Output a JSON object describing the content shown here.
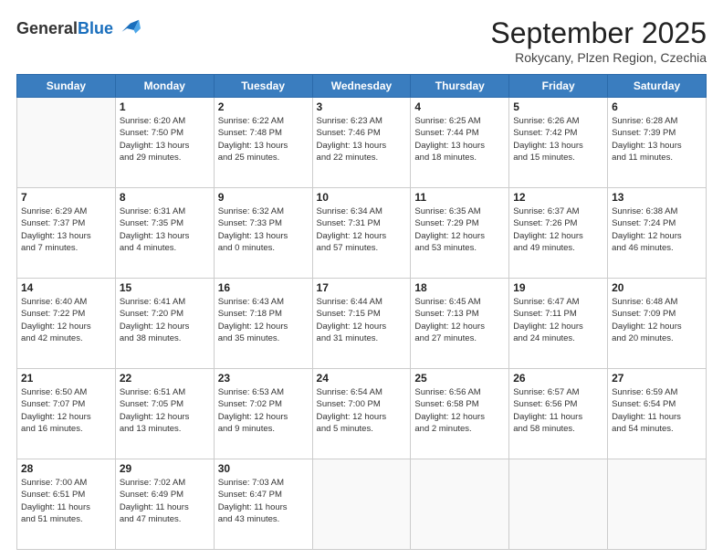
{
  "header": {
    "logo_line1": "General",
    "logo_line2": "Blue",
    "month": "September 2025",
    "location": "Rokycany, Plzen Region, Czechia"
  },
  "days_of_week": [
    "Sunday",
    "Monday",
    "Tuesday",
    "Wednesday",
    "Thursday",
    "Friday",
    "Saturday"
  ],
  "weeks": [
    [
      {
        "day": "",
        "info": ""
      },
      {
        "day": "1",
        "info": "Sunrise: 6:20 AM\nSunset: 7:50 PM\nDaylight: 13 hours\nand 29 minutes."
      },
      {
        "day": "2",
        "info": "Sunrise: 6:22 AM\nSunset: 7:48 PM\nDaylight: 13 hours\nand 25 minutes."
      },
      {
        "day": "3",
        "info": "Sunrise: 6:23 AM\nSunset: 7:46 PM\nDaylight: 13 hours\nand 22 minutes."
      },
      {
        "day": "4",
        "info": "Sunrise: 6:25 AM\nSunset: 7:44 PM\nDaylight: 13 hours\nand 18 minutes."
      },
      {
        "day": "5",
        "info": "Sunrise: 6:26 AM\nSunset: 7:42 PM\nDaylight: 13 hours\nand 15 minutes."
      },
      {
        "day": "6",
        "info": "Sunrise: 6:28 AM\nSunset: 7:39 PM\nDaylight: 13 hours\nand 11 minutes."
      }
    ],
    [
      {
        "day": "7",
        "info": "Sunrise: 6:29 AM\nSunset: 7:37 PM\nDaylight: 13 hours\nand 7 minutes."
      },
      {
        "day": "8",
        "info": "Sunrise: 6:31 AM\nSunset: 7:35 PM\nDaylight: 13 hours\nand 4 minutes."
      },
      {
        "day": "9",
        "info": "Sunrise: 6:32 AM\nSunset: 7:33 PM\nDaylight: 13 hours\nand 0 minutes."
      },
      {
        "day": "10",
        "info": "Sunrise: 6:34 AM\nSunset: 7:31 PM\nDaylight: 12 hours\nand 57 minutes."
      },
      {
        "day": "11",
        "info": "Sunrise: 6:35 AM\nSunset: 7:29 PM\nDaylight: 12 hours\nand 53 minutes."
      },
      {
        "day": "12",
        "info": "Sunrise: 6:37 AM\nSunset: 7:26 PM\nDaylight: 12 hours\nand 49 minutes."
      },
      {
        "day": "13",
        "info": "Sunrise: 6:38 AM\nSunset: 7:24 PM\nDaylight: 12 hours\nand 46 minutes."
      }
    ],
    [
      {
        "day": "14",
        "info": "Sunrise: 6:40 AM\nSunset: 7:22 PM\nDaylight: 12 hours\nand 42 minutes."
      },
      {
        "day": "15",
        "info": "Sunrise: 6:41 AM\nSunset: 7:20 PM\nDaylight: 12 hours\nand 38 minutes."
      },
      {
        "day": "16",
        "info": "Sunrise: 6:43 AM\nSunset: 7:18 PM\nDaylight: 12 hours\nand 35 minutes."
      },
      {
        "day": "17",
        "info": "Sunrise: 6:44 AM\nSunset: 7:15 PM\nDaylight: 12 hours\nand 31 minutes."
      },
      {
        "day": "18",
        "info": "Sunrise: 6:45 AM\nSunset: 7:13 PM\nDaylight: 12 hours\nand 27 minutes."
      },
      {
        "day": "19",
        "info": "Sunrise: 6:47 AM\nSunset: 7:11 PM\nDaylight: 12 hours\nand 24 minutes."
      },
      {
        "day": "20",
        "info": "Sunrise: 6:48 AM\nSunset: 7:09 PM\nDaylight: 12 hours\nand 20 minutes."
      }
    ],
    [
      {
        "day": "21",
        "info": "Sunrise: 6:50 AM\nSunset: 7:07 PM\nDaylight: 12 hours\nand 16 minutes."
      },
      {
        "day": "22",
        "info": "Sunrise: 6:51 AM\nSunset: 7:05 PM\nDaylight: 12 hours\nand 13 minutes."
      },
      {
        "day": "23",
        "info": "Sunrise: 6:53 AM\nSunset: 7:02 PM\nDaylight: 12 hours\nand 9 minutes."
      },
      {
        "day": "24",
        "info": "Sunrise: 6:54 AM\nSunset: 7:00 PM\nDaylight: 12 hours\nand 5 minutes."
      },
      {
        "day": "25",
        "info": "Sunrise: 6:56 AM\nSunset: 6:58 PM\nDaylight: 12 hours\nand 2 minutes."
      },
      {
        "day": "26",
        "info": "Sunrise: 6:57 AM\nSunset: 6:56 PM\nDaylight: 11 hours\nand 58 minutes."
      },
      {
        "day": "27",
        "info": "Sunrise: 6:59 AM\nSunset: 6:54 PM\nDaylight: 11 hours\nand 54 minutes."
      }
    ],
    [
      {
        "day": "28",
        "info": "Sunrise: 7:00 AM\nSunset: 6:51 PM\nDaylight: 11 hours\nand 51 minutes."
      },
      {
        "day": "29",
        "info": "Sunrise: 7:02 AM\nSunset: 6:49 PM\nDaylight: 11 hours\nand 47 minutes."
      },
      {
        "day": "30",
        "info": "Sunrise: 7:03 AM\nSunset: 6:47 PM\nDaylight: 11 hours\nand 43 minutes."
      },
      {
        "day": "",
        "info": ""
      },
      {
        "day": "",
        "info": ""
      },
      {
        "day": "",
        "info": ""
      },
      {
        "day": "",
        "info": ""
      }
    ]
  ]
}
